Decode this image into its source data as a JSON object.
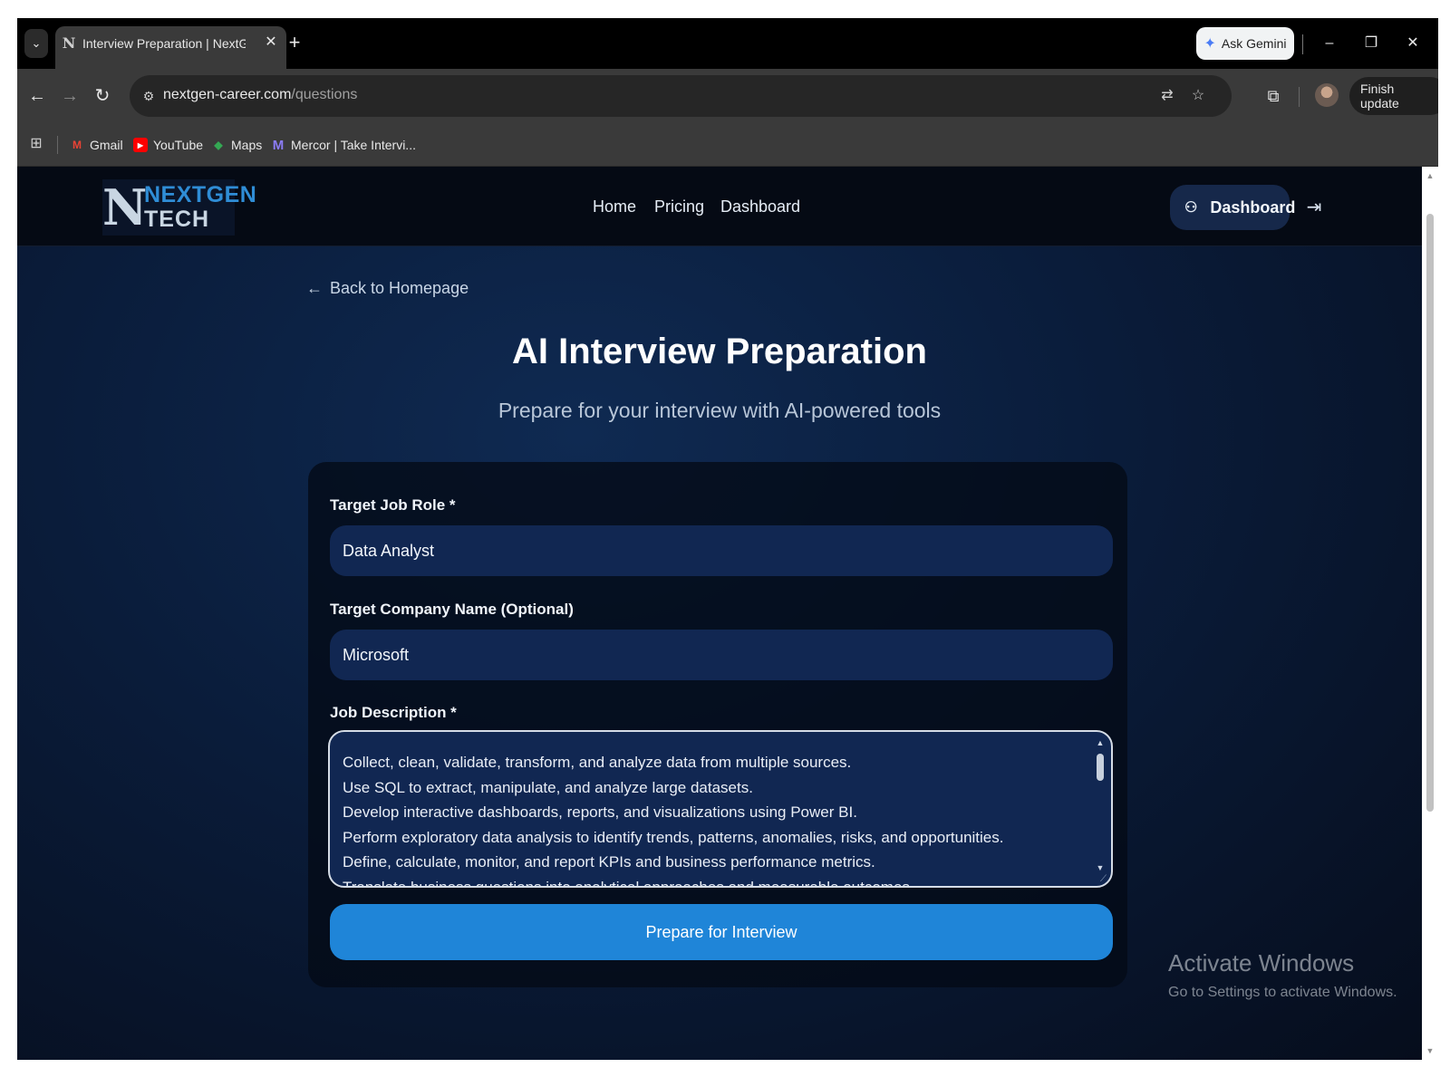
{
  "browser": {
    "tab": {
      "title": "Interview Preparation | NextGen Tech",
      "favicon": "N"
    },
    "gemini_label": "Ask Gemini",
    "url_domain": "nextgen-career.com",
    "url_path": "/questions",
    "finish_update_label": "Finish update",
    "bookmarks": [
      {
        "label": "Gmail",
        "icon": "M"
      },
      {
        "label": "YouTube",
        "icon": "▶"
      },
      {
        "label": "Maps",
        "icon": "◆"
      },
      {
        "label": "Mercor | Take Intervi...",
        "icon": "M"
      }
    ]
  },
  "site": {
    "logo": {
      "mark": "N",
      "line1": "NEXTGEN",
      "line2": "TECH"
    },
    "nav": [
      {
        "label": "Home"
      },
      {
        "label": "Pricing"
      },
      {
        "label": "Dashboard"
      }
    ],
    "dashboard_button": "Dashboard"
  },
  "main": {
    "back_link": "Back to Homepage",
    "title": "AI Interview Preparation",
    "subtitle": "Prepare for your interview with AI-powered tools",
    "form": {
      "job_role_label": "Target Job Role *",
      "job_role_value": "Data Analyst",
      "company_label": "Target Company Name (Optional)",
      "company_value": "Microsoft",
      "description_label": "Job Description *",
      "description_lines": [
        "Collect, clean, validate, transform, and analyze data from multiple sources.",
        "Use SQL to extract, manipulate, and analyze large datasets.",
        "Develop interactive dashboards, reports, and visualizations using Power BI.",
        "Perform exploratory data analysis to identify trends, patterns, anomalies, risks, and opportunities.",
        "Define, calculate, monitor, and report KPIs and business performance metrics.",
        "Translate business questions into analytical approaches and measurable outcomes."
      ],
      "submit_label": "Prepare for Interview"
    }
  },
  "watermark": {
    "line1": "Activate Windows",
    "line2": "Go to Settings to activate Windows."
  },
  "colors": {
    "accent_button": "#1f85d8",
    "input_bg": "#112752",
    "logo_blue": "#2f8dd6"
  }
}
